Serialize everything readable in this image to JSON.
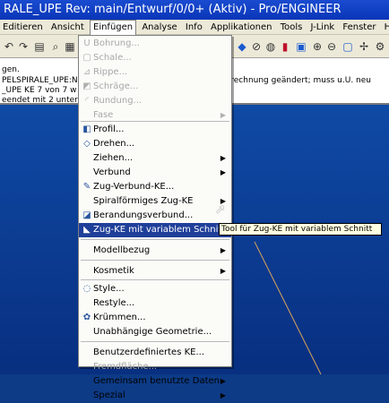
{
  "title": "RALE_UPE Rev: main/Entwurf/0/0+ (Aktiv) - Pro/ENGINEER",
  "menubar": [
    "Editieren",
    "Ansicht",
    "Einfügen",
    "Analyse",
    "Info",
    "Applikationen",
    "Tools",
    "J-Link",
    "Fenster",
    "Hilfe"
  ],
  "messages": {
    "line1": "gen.",
    "line2": "PELSPIRALE_UPE:N",
    "line2b": "berechnung geändert; muss u.U. neu",
    "line3": "_UPE KE 7 von 7 w",
    "line4": "eendet mit 2 unter"
  },
  "menu": {
    "items": [
      {
        "label": "Bohrung...",
        "icon": "hole-icon",
        "glyph": "U",
        "disabled": true,
        "submenu": false
      },
      {
        "label": "Schale...",
        "icon": "shell-icon",
        "glyph": "▢",
        "disabled": true,
        "submenu": false
      },
      {
        "label": "Rippe...",
        "icon": "rib-icon",
        "glyph": "⊿",
        "disabled": true,
        "submenu": false
      },
      {
        "label": "Schräge...",
        "icon": "draft-icon",
        "glyph": "◩",
        "disabled": true,
        "submenu": false
      },
      {
        "label": "Rundung...",
        "icon": "round-icon",
        "glyph": "◜",
        "disabled": true,
        "submenu": false
      },
      {
        "label": "Fase",
        "icon": "",
        "glyph": "",
        "disabled": true,
        "submenu": true
      },
      {
        "label": "Profil...",
        "icon": "extrude-icon",
        "glyph": "◧",
        "disabled": false,
        "submenu": false
      },
      {
        "label": "Drehen...",
        "icon": "revolve-icon",
        "glyph": "◇",
        "disabled": false,
        "submenu": false
      },
      {
        "label": "Ziehen...",
        "icon": "",
        "glyph": "",
        "disabled": false,
        "submenu": true
      },
      {
        "label": "Verbund",
        "icon": "",
        "glyph": "",
        "disabled": false,
        "submenu": true
      },
      {
        "label": "Zug-Verbund-KE...",
        "icon": "swept-blend-icon",
        "glyph": "✎",
        "disabled": false,
        "submenu": false
      },
      {
        "label": "Spiralförmiges Zug-KE",
        "icon": "",
        "glyph": "",
        "disabled": false,
        "submenu": true
      },
      {
        "label": "Berandungsverbund...",
        "icon": "boundary-blend-icon",
        "glyph": "◪",
        "disabled": false,
        "submenu": false
      },
      {
        "label": "Zug-KE mit variablem Schnitt...",
        "icon": "variable-section-sweep-icon",
        "glyph": "◣",
        "disabled": false,
        "submenu": false,
        "highlighted": true
      },
      {
        "label": "Modellbezug",
        "icon": "",
        "glyph": "",
        "disabled": false,
        "submenu": true
      },
      {
        "label": "Kosmetik",
        "icon": "",
        "glyph": "",
        "disabled": false,
        "submenu": true
      },
      {
        "label": "Style...",
        "icon": "style-icon",
        "glyph": "◌",
        "disabled": false,
        "submenu": false
      },
      {
        "label": "Restyle...",
        "icon": "",
        "glyph": "",
        "disabled": false,
        "submenu": false
      },
      {
        "label": "Krümmen...",
        "icon": "warp-icon",
        "glyph": "✿",
        "disabled": false,
        "submenu": false
      },
      {
        "label": "Unabhängige Geometrie...",
        "icon": "",
        "glyph": "",
        "disabled": false,
        "submenu": false
      },
      {
        "label": "Benutzerdefiniertes KE...",
        "icon": "",
        "glyph": "",
        "disabled": false,
        "submenu": false
      },
      {
        "label": "Fremdfläche...",
        "icon": "",
        "glyph": "",
        "disabled": true,
        "submenu": false
      },
      {
        "label": "Gemeinsam benutzte Daten",
        "icon": "",
        "glyph": "",
        "disabled": false,
        "submenu": true
      },
      {
        "label": "Spezial",
        "icon": "",
        "glyph": "",
        "disabled": false,
        "submenu": true
      }
    ]
  },
  "tooltip": "Tool für Zug-KE mit variablem Schnitt"
}
